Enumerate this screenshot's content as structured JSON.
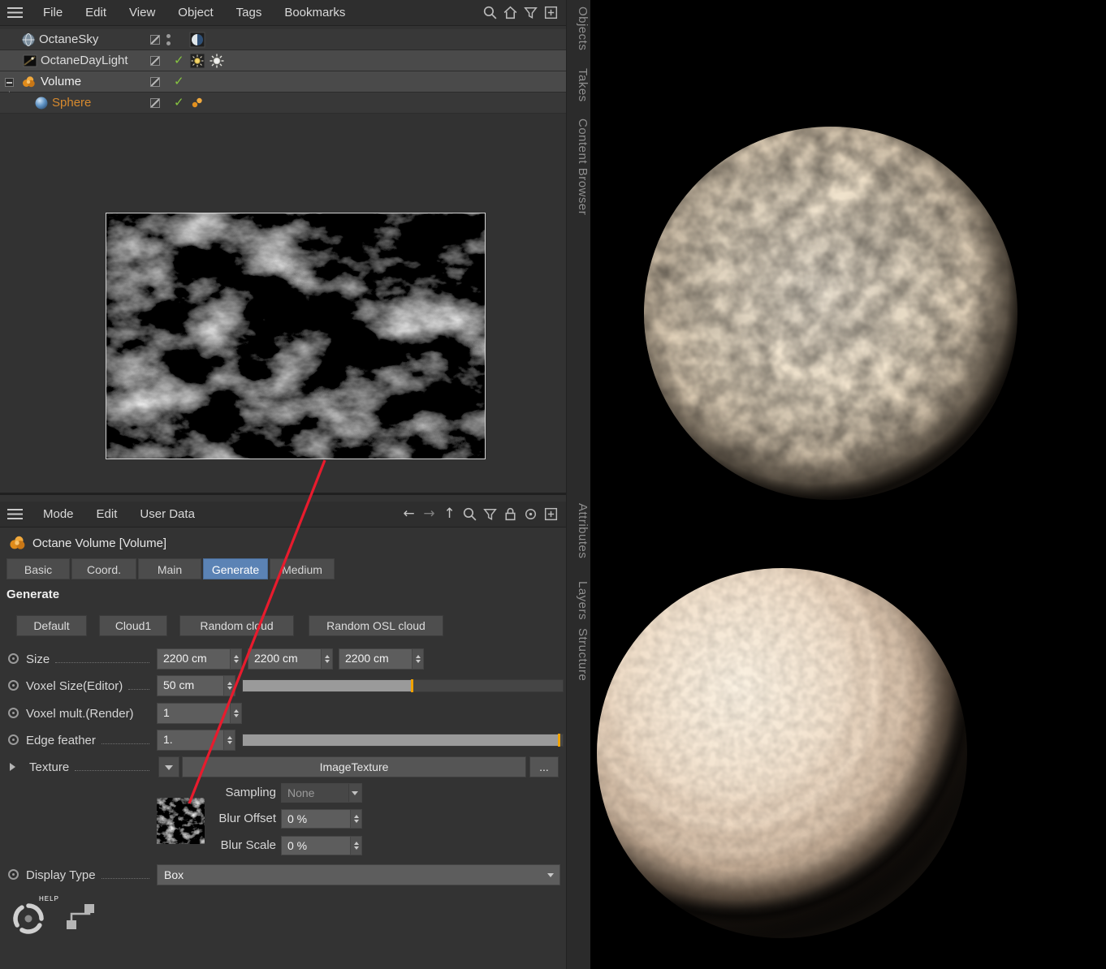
{
  "object_manager": {
    "menu": {
      "file": "File",
      "edit": "Edit",
      "view": "View",
      "object": "Object",
      "tags": "Tags",
      "bookmarks": "Bookmarks"
    },
    "objects": [
      {
        "name": "OctaneSky"
      },
      {
        "name": "OctaneDayLight"
      },
      {
        "name": "Volume"
      },
      {
        "name": "Sphere"
      }
    ]
  },
  "side_tabs": {
    "objects": "Objects",
    "takes": "Takes",
    "content_browser": "Content Browser",
    "attributes": "Attributes",
    "layers": "Layers",
    "structure": "Structure"
  },
  "attribute_manager": {
    "menu": {
      "mode": "Mode",
      "edit": "Edit",
      "user_data": "User Data"
    },
    "title": "Octane Volume [Volume]",
    "tabs": {
      "basic": "Basic",
      "coord": "Coord.",
      "main": "Main",
      "generate": "Generate",
      "medium": "Medium"
    },
    "active_tab": "Generate",
    "section_header": "Generate",
    "presets": {
      "default": "Default",
      "cloud1": "Cloud1",
      "random_cloud": "Random cloud",
      "random_osl_cloud": "Random OSL cloud"
    },
    "size": {
      "label": "Size",
      "x": "2200 cm",
      "y": "2200 cm",
      "z": "2200 cm"
    },
    "voxel_size": {
      "label": "Voxel Size(Editor)",
      "value": "50 cm"
    },
    "voxel_mult": {
      "label": "Voxel mult.(Render)",
      "value": "1"
    },
    "edge_feather": {
      "label": "Edge feather",
      "value": "1."
    },
    "texture": {
      "label": "Texture",
      "value": "ImageTexture",
      "more": "..."
    },
    "sampling": {
      "label": "Sampling",
      "value": "None"
    },
    "blur_offset": {
      "label": "Blur Offset",
      "value": "0 %"
    },
    "blur_scale": {
      "label": "Blur Scale",
      "value": "0 %"
    },
    "display_type": {
      "label": "Display Type",
      "value": "Box"
    },
    "help": "HELP"
  },
  "colors": {
    "accent_orange": "#d78a2e",
    "tab_active_blue": "#5b83b5",
    "slider_marker_orange": "#f0a202",
    "annotation_red": "#e81b2d",
    "check_green": "#86c440"
  }
}
